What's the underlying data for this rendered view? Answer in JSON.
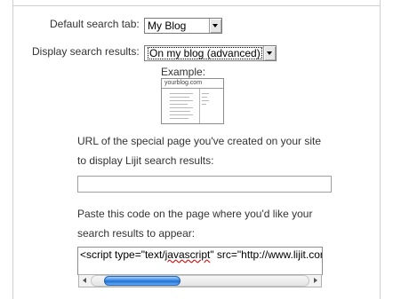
{
  "settings": {
    "default_search_tab_label": "Default search tab:",
    "default_search_tab_value": "My Blog",
    "display_results_label": "Display search results:",
    "display_results_value": "On my blog (advanced)"
  },
  "example": {
    "label": "Example:",
    "preview_domain": "yourblog.com"
  },
  "url_section": {
    "line1": "URL of the special page you've created on your site",
    "line2": "to display Lijit search results:",
    "input_value": ""
  },
  "code_section": {
    "line1": "Paste this code on the page where you'd like your",
    "line2": "search results to appear:",
    "code_before": "<script type=\"text/",
    "code_misspelled": "javascript",
    "code_after": "\" src=\"http://www.lijit.com"
  },
  "icons": {
    "dropdown": "chevron-down-icon",
    "scroll_left": "arrow-left-icon",
    "scroll_right": "arrow-right-icon"
  },
  "colors": {
    "scroll_thumb": "#3b8ee8",
    "spell_error": "#d02020"
  }
}
